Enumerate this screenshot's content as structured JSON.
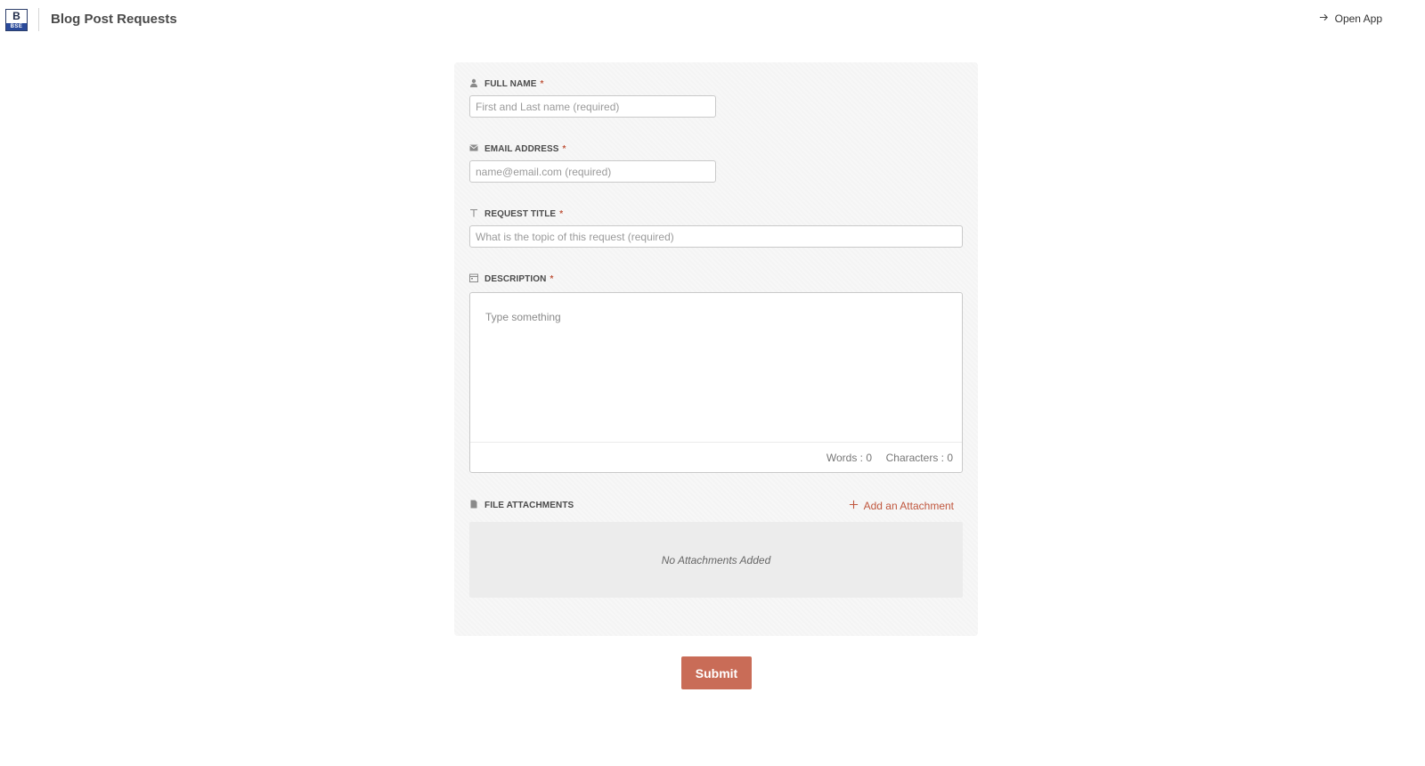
{
  "header": {
    "logo_letter": "B",
    "logo_subtext": "BSE",
    "title": "Blog Post Requests",
    "open_app_label": "Open App"
  },
  "form": {
    "full_name": {
      "label": "FULL NAME",
      "required_mark": "*",
      "icon": "user-icon",
      "placeholder": "First and Last name (required)",
      "value": ""
    },
    "email": {
      "label": "EMAIL ADDRESS",
      "required_mark": "*",
      "icon": "envelope-icon",
      "placeholder": "name@email.com (required)",
      "value": ""
    },
    "request_title": {
      "label": "REQUEST TITLE",
      "required_mark": "*",
      "icon": "text-icon",
      "placeholder": "What is the topic of this request (required)",
      "value": ""
    },
    "description": {
      "label": "DESCRIPTION",
      "required_mark": "*",
      "icon": "calendar-icon",
      "placeholder": "Type something",
      "value": "",
      "words_label": "Words : 0",
      "characters_label": "Characters : 0"
    },
    "attachments": {
      "label": "FILE ATTACHMENTS",
      "icon": "file-icon",
      "add_label": "Add an Attachment",
      "empty_text": "No Attachments Added"
    },
    "submit_label": "Submit"
  },
  "colors": {
    "accent": "#c0573e",
    "submit_bg": "#c96c57",
    "card_bg": "#f7f7f7"
  }
}
